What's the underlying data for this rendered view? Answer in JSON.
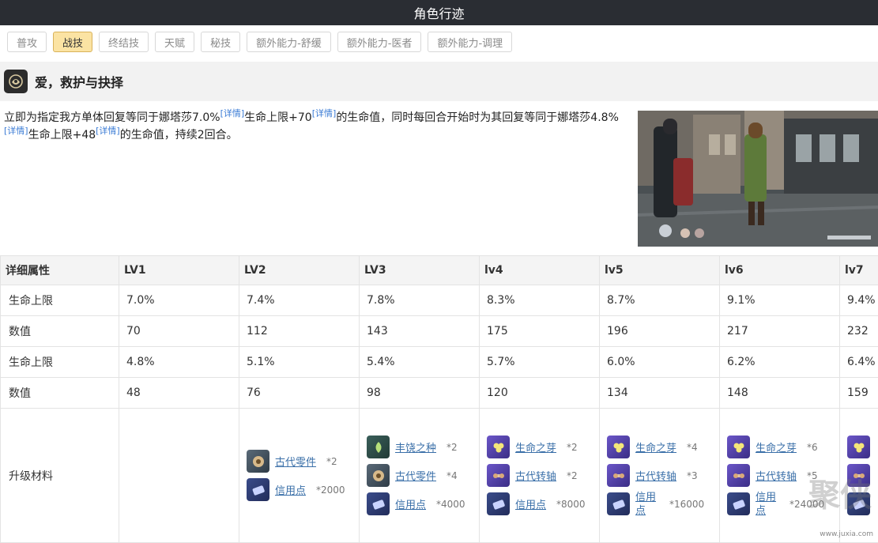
{
  "header": {
    "title": "角色行迹"
  },
  "tabs": [
    {
      "label": "普攻",
      "active": false
    },
    {
      "label": "战技",
      "active": true
    },
    {
      "label": "终结技",
      "active": false
    },
    {
      "label": "天赋",
      "active": false
    },
    {
      "label": "秘技",
      "active": false
    },
    {
      "label": "额外能力-舒缓",
      "active": false
    },
    {
      "label": "额外能力-医者",
      "active": false
    },
    {
      "label": "额外能力-调理",
      "active": false
    }
  ],
  "skill": {
    "name": "爱，救护与抉择",
    "icon": "skill-emblem-icon",
    "desc": {
      "p1": "立即为指定我方单体回复等同于娜塔莎7.0%",
      "tag": "[详情]",
      "p2": "生命上限+70",
      "p3": "的生命值，同时每回合开始时为其回复等同于娜塔莎4.8%",
      "p4": "生命上限+48",
      "p5": "的生命值，持续2回合。"
    }
  },
  "table": {
    "headers": [
      "详细属性",
      "LV1",
      "LV2",
      "LV3",
      "lv4",
      "lv5",
      "lv6",
      "lv7"
    ],
    "rows": [
      [
        "生命上限",
        "7.0%",
        "7.4%",
        "7.8%",
        "8.3%",
        "8.7%",
        "9.1%",
        "9.4%"
      ],
      [
        "数值",
        "70",
        "112",
        "143",
        "175",
        "196",
        "217",
        "232"
      ],
      [
        "生命上限",
        "4.8%",
        "5.1%",
        "5.4%",
        "5.7%",
        "6.0%",
        "6.2%",
        "6.4%"
      ],
      [
        "数值",
        "48",
        "76",
        "98",
        "120",
        "134",
        "148",
        "159"
      ]
    ],
    "materials_label": "升级材料",
    "materials": [
      [],
      [
        {
          "name": "古代零件",
          "qty": "*2",
          "icon": "ancient-part-icon"
        },
        {
          "name": "信用点",
          "qty": "*2000",
          "icon": "credit-icon"
        }
      ],
      [
        {
          "name": "丰饶之种",
          "qty": "*2",
          "icon": "seed-icon"
        },
        {
          "name": "古代零件",
          "qty": "*4",
          "icon": "ancient-part-icon"
        },
        {
          "name": "信用点",
          "qty": "*4000",
          "icon": "credit-icon"
        }
      ],
      [
        {
          "name": "生命之芽",
          "qty": "*2",
          "icon": "sprout-icon"
        },
        {
          "name": "古代转轴",
          "qty": "*2",
          "icon": "ancient-spindle-icon"
        },
        {
          "name": "信用点",
          "qty": "*8000",
          "icon": "credit-icon"
        }
      ],
      [
        {
          "name": "生命之芽",
          "qty": "*4",
          "icon": "sprout-icon"
        },
        {
          "name": "古代转轴",
          "qty": "*3",
          "icon": "ancient-spindle-icon"
        },
        {
          "name": "信用点",
          "qty": "*16000",
          "icon": "credit-icon"
        }
      ],
      [
        {
          "name": "生命之芽",
          "qty": "*6",
          "icon": "sprout-icon"
        },
        {
          "name": "古代转轴",
          "qty": "*5",
          "icon": "ancient-spindle-icon"
        },
        {
          "name": "信用点",
          "qty": "*24000",
          "icon": "credit-icon"
        }
      ],
      [
        {
          "name": "",
          "qty": "",
          "icon": "sprout-icon"
        },
        {
          "name": "",
          "qty": "",
          "icon": "ancient-spindle-icon"
        },
        {
          "name": "",
          "qty": "",
          "icon": "credit-icon"
        }
      ]
    ]
  },
  "watermark": {
    "glyph": "聚侠网",
    "url": "www.juxia.com"
  }
}
